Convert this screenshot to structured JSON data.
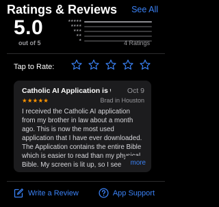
{
  "header": {
    "title": "Ratings & Reviews",
    "see_all": "See All"
  },
  "summary": {
    "score": "5.0",
    "out_of": "out of 5",
    "ratings_count": "4 Ratings",
    "distribution": [
      {
        "stars": "★★★★★",
        "fraction": 1.0
      },
      {
        "stars": "★★★★",
        "fraction": 0.0
      },
      {
        "stars": "★★★",
        "fraction": 0.0
      },
      {
        "stars": "★★",
        "fraction": 0.0
      },
      {
        "stars": "★",
        "fraction": 0.0
      }
    ]
  },
  "tap_to_rate": {
    "label": "Tap to Rate:",
    "star_icon": "star-outline-icon",
    "star_count": 5
  },
  "review": {
    "title": "Catholic AI Application is wond...",
    "date": "Oct 9",
    "stars": "★★★★★",
    "author": "Brad in Houston",
    "body": "I received the Catholic AI application from my brother in law about a month ago.  This is now the most used application that I have ever downloaded.  The Application contains the entire Bible which is easier to read than my physical Bible.  My screen is lit up, so I see",
    "more": "more"
  },
  "actions": {
    "write_review": {
      "label": "Write a Review",
      "icon": "compose-icon"
    },
    "app_support": {
      "label": "App Support",
      "icon": "question-circle-icon"
    }
  },
  "colors": {
    "background": "#000000",
    "accent": "#3b82f6",
    "star_rating": "#ff9500",
    "card": "#1c1c1e",
    "secondary_text": "#9a9a9e"
  }
}
